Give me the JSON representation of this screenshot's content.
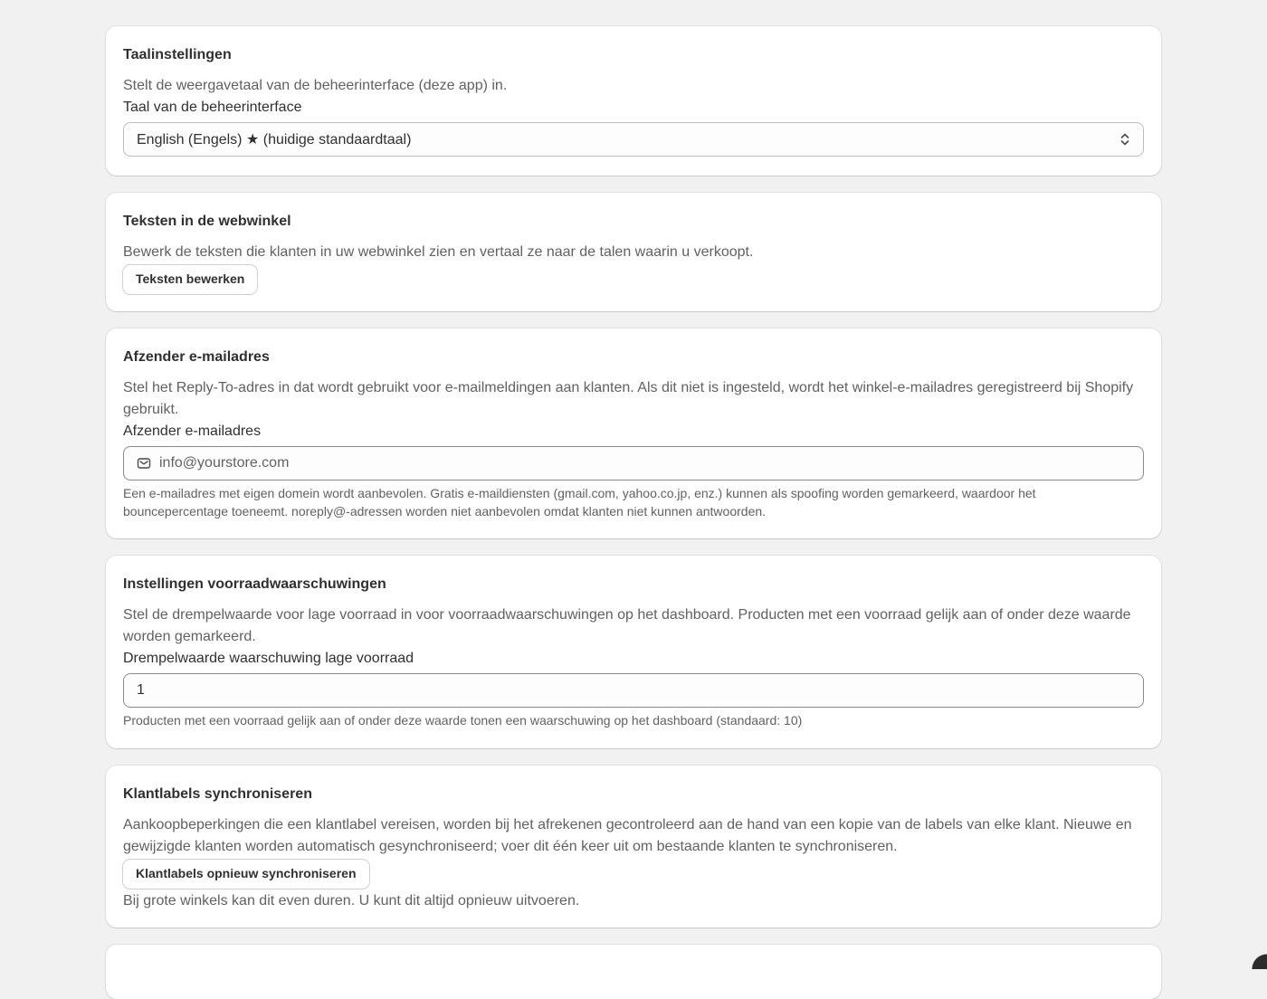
{
  "language": {
    "title": "Taalinstellingen",
    "description": "Stelt de weergavetaal van de beheerinterface (deze app) in.",
    "field_label": "Taal van de beheerinterface",
    "selected_value": "English (Engels) ★ (huidige standaardtaal)"
  },
  "storefront_texts": {
    "title": "Teksten in de webwinkel",
    "description": "Bewerk de teksten die klanten in uw webwinkel zien en vertaal ze naar de talen waarin u verkoopt.",
    "button_label": "Teksten bewerken"
  },
  "sender_email": {
    "title": "Afzender e-mailadres",
    "description": "Stel het Reply-To-adres in dat wordt gebruikt voor e-mailmeldingen aan klanten. Als dit niet is ingesteld, wordt het winkel-e-mailadres geregistreerd bij Shopify gebruikt.",
    "field_label": "Afzender e-mailadres",
    "placeholder": "info@yourstore.com",
    "help": "Een e-mailadres met eigen domein wordt aanbevolen. Gratis e-maildiensten (gmail.com, yahoo.co.jp, enz.) kunnen als spoofing worden gemarkeerd, waardoor het bouncepercentage toeneemt. noreply@-adressen worden niet aanbevolen omdat klanten niet kunnen antwoorden.",
    "icon": "mail-icon"
  },
  "stock_alerts": {
    "title": "Instellingen voorraadwaarschuwingen",
    "description": "Stel de drempelwaarde voor lage voorraad in voor voorraadwaarschuwingen op het dashboard. Producten met een voorraad gelijk aan of onder deze waarde worden gemarkeerd.",
    "field_label": "Drempelwaarde waarschuwing lage voorraad",
    "value": "1",
    "help": "Producten met een voorraad gelijk aan of onder deze waarde tonen een waarschuwing op het dashboard (standaard: 10)"
  },
  "customer_tags": {
    "title": "Klantlabels synchroniseren",
    "description": "Aankoopbeperkingen die een klantlabel vereisen, worden bij het afrekenen gecontroleerd aan de hand van een kopie van de labels van elke klant. Nieuwe en gewijzigde klanten worden automatisch gesynchroniseerd; voer dit één keer uit om bestaande klanten te synchroniseren.",
    "button_label": "Klantlabels opnieuw synchroniseren",
    "note": "Bij grote winkels kan dit even duren. U kunt dit altijd opnieuw uitvoeren."
  },
  "colors": {
    "background": "#f1f1f1",
    "card": "#ffffff",
    "text": "#303030",
    "muted_text": "#616161",
    "border": "#8a8a8a"
  }
}
